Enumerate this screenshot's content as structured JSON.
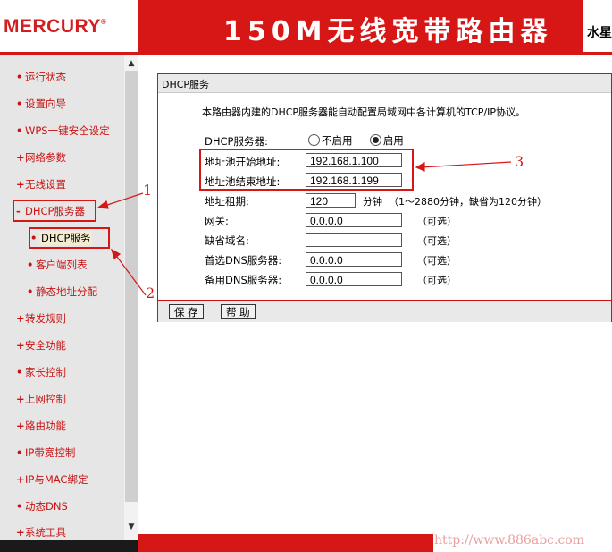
{
  "header": {
    "logo": "MERCURY",
    "logo_mark": "®",
    "title": "150M无线宽带路由器",
    "right_text": "水星"
  },
  "sidebar": {
    "items": [
      {
        "label": "运行状态",
        "mark": "•"
      },
      {
        "label": "设置向导",
        "mark": "•"
      },
      {
        "label": "WPS一键安全设定",
        "mark": "•"
      },
      {
        "label": "网络参数",
        "mark": "+"
      },
      {
        "label": "无线设置",
        "mark": "+"
      },
      {
        "label": "DHCP服务器",
        "mark": "-"
      },
      {
        "label": "DHCP服务",
        "mark": "•"
      },
      {
        "label": "客户端列表",
        "mark": "•"
      },
      {
        "label": "静态地址分配",
        "mark": "•"
      },
      {
        "label": "转发规则",
        "mark": "+"
      },
      {
        "label": "安全功能",
        "mark": "+"
      },
      {
        "label": "家长控制",
        "mark": "•"
      },
      {
        "label": "上网控制",
        "mark": "+"
      },
      {
        "label": "路由功能",
        "mark": "+"
      },
      {
        "label": "IP带宽控制",
        "mark": "•"
      },
      {
        "label": "IP与MAC绑定",
        "mark": "+"
      },
      {
        "label": "动态DNS",
        "mark": "•"
      },
      {
        "label": "系统工具",
        "mark": "+"
      }
    ]
  },
  "panel": {
    "title": "DHCP服务",
    "intro": "本路由器内建的DHCP服务器能自动配置局域网中各计算机的TCP/IP协议。",
    "dhcp_server_label": "DHCP服务器:",
    "disable_label": "不启用",
    "enable_label": "启用",
    "start_label": "地址池开始地址:",
    "start_value": "192.168.1.100",
    "end_label": "地址池结束地址:",
    "end_value": "192.168.1.199",
    "lease_label": "地址租期:",
    "lease_value": "120",
    "lease_unit": "分钟",
    "lease_hint": "（1～2880分钟，缺省为120分钟）",
    "gateway_label": "网关:",
    "gateway_value": "0.0.0.0",
    "domain_label": "缺省域名:",
    "domain_value": "",
    "dns1_label": "首选DNS服务器:",
    "dns1_value": "0.0.0.0",
    "dns2_label": "备用DNS服务器:",
    "dns2_value": "0.0.0.0",
    "optional": "（可选）",
    "save_label": "保 存",
    "help_label": "帮 助"
  },
  "annotations": {
    "n1": "1",
    "n2": "2",
    "n3": "3"
  },
  "colors": {
    "brand_red": "#d71616",
    "sidebar_bg": "#e6e6e6",
    "nav_text": "#c81414"
  },
  "watermark": "http://www.886abc.com"
}
